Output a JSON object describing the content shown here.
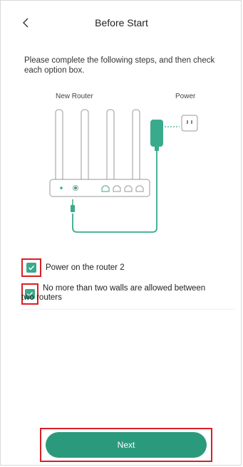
{
  "header": {
    "title": "Before Start",
    "back_icon": "chevron-left-icon"
  },
  "instructions": "Please complete the following steps, and then check each option box.",
  "illustration": {
    "router_label": "New Router",
    "power_label": "Power"
  },
  "checklist": [
    {
      "label": "Power on the router 2",
      "checked": true
    },
    {
      "label_line1": "No more than two walls are allowed between",
      "label_line2": "two routers",
      "checked": true
    }
  ],
  "footer": {
    "next_label": "Next"
  },
  "colors": {
    "accent": "#3aaa8c",
    "button": "#2b9a7c",
    "highlight": "#d81f26"
  }
}
